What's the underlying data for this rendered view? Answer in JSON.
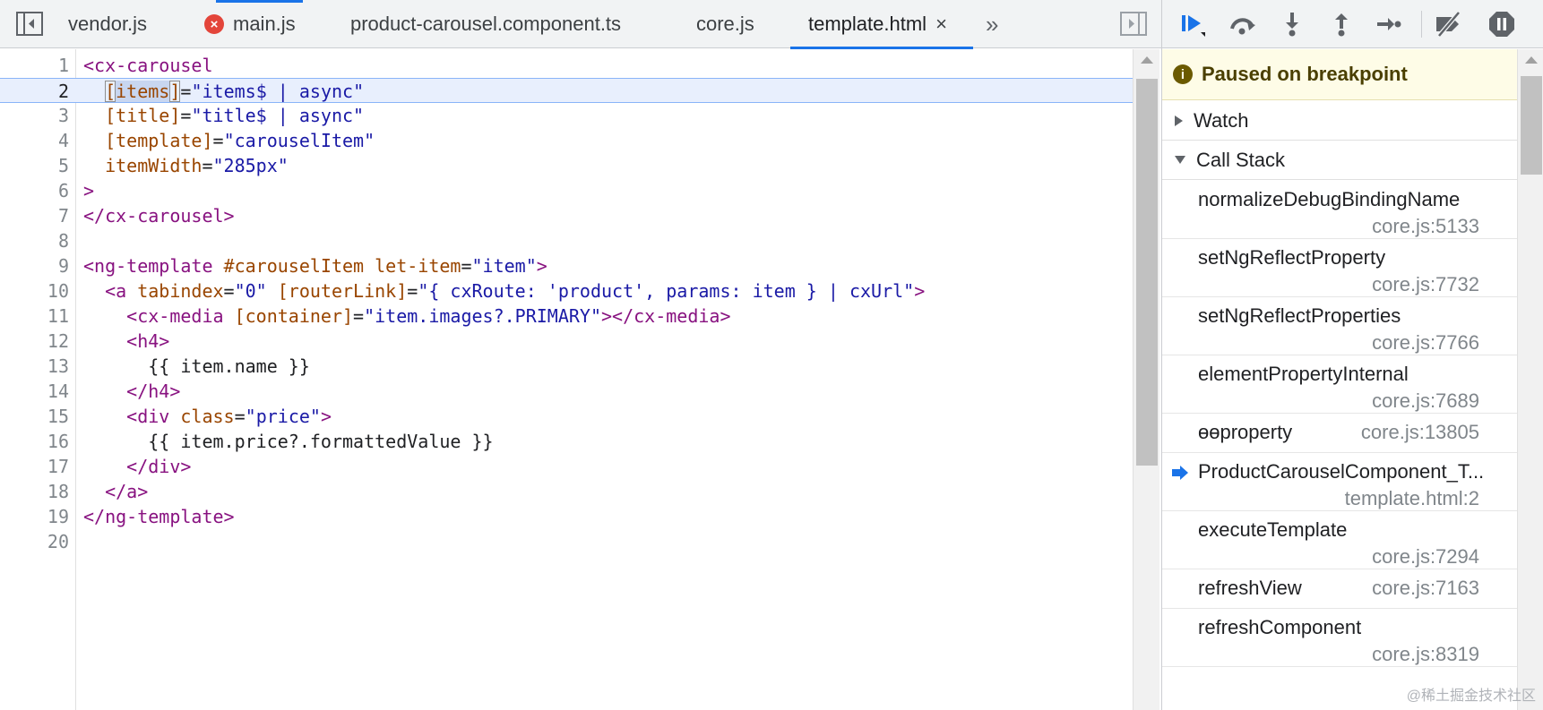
{
  "tabs": [
    {
      "label": "vendor.js",
      "error": false,
      "active": false
    },
    {
      "label": "main.js",
      "error": true,
      "active": false
    },
    {
      "label": "product-carousel.component.ts",
      "error": false,
      "active": false
    },
    {
      "label": "core.js",
      "error": false,
      "active": false
    },
    {
      "label": "template.html",
      "error": false,
      "active": true
    }
  ],
  "tab_close_glyph": "×",
  "tab_overflow_glyph": "»",
  "error_glyph": "×",
  "editor": {
    "current_line": 2,
    "lines": [
      {
        "n": "1",
        "tokens": [
          {
            "t": "tag",
            "s": "<cx-carousel"
          }
        ]
      },
      {
        "n": "2",
        "tokens": [
          {
            "t": "txt",
            "s": "  "
          },
          {
            "t": "attr",
            "s": "[",
            "box": true
          },
          {
            "t": "attr",
            "s": "items",
            "sel": true
          },
          {
            "t": "attr",
            "s": "]",
            "box": true
          },
          {
            "t": "txt",
            "s": "="
          },
          {
            "t": "val",
            "s": "\"items$ | async\""
          }
        ]
      },
      {
        "n": "3",
        "tokens": [
          {
            "t": "txt",
            "s": "  "
          },
          {
            "t": "attr",
            "s": "[title]"
          },
          {
            "t": "txt",
            "s": "="
          },
          {
            "t": "val",
            "s": "\"title$ | async\""
          }
        ]
      },
      {
        "n": "4",
        "tokens": [
          {
            "t": "txt",
            "s": "  "
          },
          {
            "t": "attr",
            "s": "[template]"
          },
          {
            "t": "txt",
            "s": "="
          },
          {
            "t": "val",
            "s": "\"carouselItem\""
          }
        ]
      },
      {
        "n": "5",
        "tokens": [
          {
            "t": "txt",
            "s": "  "
          },
          {
            "t": "attr",
            "s": "itemWidth"
          },
          {
            "t": "txt",
            "s": "="
          },
          {
            "t": "val",
            "s": "\"285px\""
          }
        ]
      },
      {
        "n": "6",
        "tokens": [
          {
            "t": "tag",
            "s": ">"
          }
        ]
      },
      {
        "n": "7",
        "tokens": [
          {
            "t": "tag",
            "s": "</cx-carousel>"
          }
        ]
      },
      {
        "n": "8",
        "tokens": []
      },
      {
        "n": "9",
        "tokens": [
          {
            "t": "tag",
            "s": "<ng-template "
          },
          {
            "t": "attr",
            "s": "#carouselItem let-item"
          },
          {
            "t": "txt",
            "s": "="
          },
          {
            "t": "val",
            "s": "\"item\""
          },
          {
            "t": "tag",
            "s": ">"
          }
        ]
      },
      {
        "n": "10",
        "tokens": [
          {
            "t": "txt",
            "s": "  "
          },
          {
            "t": "tag",
            "s": "<a "
          },
          {
            "t": "attr",
            "s": "tabindex"
          },
          {
            "t": "txt",
            "s": "="
          },
          {
            "t": "val",
            "s": "\"0\""
          },
          {
            "t": "txt",
            "s": " "
          },
          {
            "t": "attr",
            "s": "[routerLink]"
          },
          {
            "t": "txt",
            "s": "="
          },
          {
            "t": "val",
            "s": "\"{ cxRoute: 'product', params: item } | cxUrl\""
          },
          {
            "t": "tag",
            "s": ">"
          }
        ]
      },
      {
        "n": "11",
        "tokens": [
          {
            "t": "txt",
            "s": "    "
          },
          {
            "t": "tag",
            "s": "<cx-media "
          },
          {
            "t": "attr",
            "s": "[container]"
          },
          {
            "t": "txt",
            "s": "="
          },
          {
            "t": "val",
            "s": "\"item.images?.PRIMARY\""
          },
          {
            "t": "tag",
            "s": "></cx-media>"
          }
        ]
      },
      {
        "n": "12",
        "tokens": [
          {
            "t": "txt",
            "s": "    "
          },
          {
            "t": "tag",
            "s": "<h4>"
          }
        ]
      },
      {
        "n": "13",
        "tokens": [
          {
            "t": "txt",
            "s": "      {{ item.name }}"
          }
        ]
      },
      {
        "n": "14",
        "tokens": [
          {
            "t": "txt",
            "s": "    "
          },
          {
            "t": "tag",
            "s": "</h4>"
          }
        ]
      },
      {
        "n": "15",
        "tokens": [
          {
            "t": "txt",
            "s": "    "
          },
          {
            "t": "tag",
            "s": "<div "
          },
          {
            "t": "attr",
            "s": "class"
          },
          {
            "t": "txt",
            "s": "="
          },
          {
            "t": "val",
            "s": "\"price\""
          },
          {
            "t": "tag",
            "s": ">"
          }
        ]
      },
      {
        "n": "16",
        "tokens": [
          {
            "t": "txt",
            "s": "      {{ item.price?.formattedValue }}"
          }
        ]
      },
      {
        "n": "17",
        "tokens": [
          {
            "t": "txt",
            "s": "    "
          },
          {
            "t": "tag",
            "s": "</div>"
          }
        ]
      },
      {
        "n": "18",
        "tokens": [
          {
            "t": "txt",
            "s": "  "
          },
          {
            "t": "tag",
            "s": "</a>"
          }
        ]
      },
      {
        "n": "19",
        "tokens": [
          {
            "t": "tag",
            "s": "</ng-template>"
          }
        ]
      },
      {
        "n": "20",
        "tokens": []
      }
    ]
  },
  "debugger": {
    "toolbar_icons": [
      "resume-icon",
      "step-over-icon",
      "step-into-icon",
      "step-out-icon",
      "step-icon",
      "deactivate-breakpoints-icon",
      "pause-on-exceptions-icon"
    ],
    "paused_glyph": "i",
    "paused_text": "Paused on breakpoint",
    "watch_label": "Watch",
    "callstack_label": "Call Stack",
    "frames": [
      {
        "fn": "normalizeDebugBindingName",
        "loc": "core.js:5133",
        "two_line": true,
        "current": false
      },
      {
        "fn": "setNgReflectProperty",
        "loc": "core.js:7732",
        "two_line": true,
        "current": false
      },
      {
        "fn": "setNgReflectProperties",
        "loc": "core.js:7766",
        "two_line": true,
        "current": false
      },
      {
        "fn": "elementPropertyInternal",
        "loc": "core.js:7689",
        "two_line": true,
        "current": false
      },
      {
        "fn": "ɵɵproperty",
        "loc": "core.js:13805",
        "two_line": false,
        "current": false
      },
      {
        "fn": "ProductCarouselComponent_T...",
        "loc": "template.html:2",
        "two_line": true,
        "current": true
      },
      {
        "fn": "executeTemplate",
        "loc": "core.js:7294",
        "two_line": true,
        "current": false
      },
      {
        "fn": "refreshView",
        "loc": "core.js:7163",
        "two_line": false,
        "current": false
      },
      {
        "fn": "refreshComponent",
        "loc": "core.js:8319",
        "two_line": true,
        "current": false
      }
    ]
  },
  "watermark": "@稀土掘金技术社区",
  "colors": {
    "accent": "#1a73e8",
    "tag": "#881280",
    "attr": "#994500",
    "value": "#1a1aa6",
    "paused_bg": "#fefce7"
  }
}
